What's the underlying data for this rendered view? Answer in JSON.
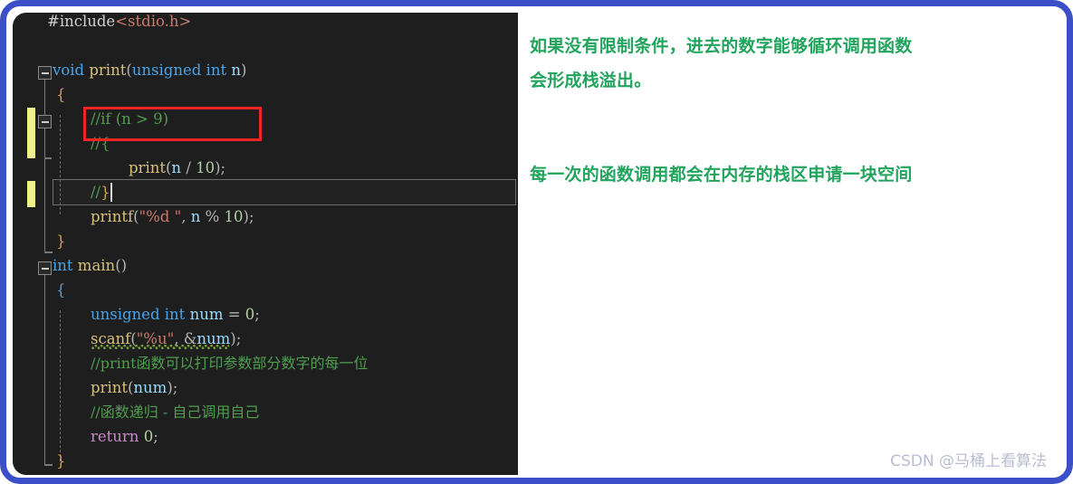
{
  "frame": {
    "border_color": "#3b50c8"
  },
  "editor": {
    "background": "#1e1e1e",
    "lines": [
      {
        "indent": 2,
        "text": "#include<stdio.h>"
      },
      {
        "indent": 0,
        "text": ""
      },
      {
        "indent": 1,
        "text": "void print(unsigned int n)"
      },
      {
        "indent": 2,
        "text": "{"
      },
      {
        "indent": 3,
        "text": "//if (n > 9)"
      },
      {
        "indent": 3,
        "text": "//{"
      },
      {
        "indent": 4,
        "text": "print(n / 10);"
      },
      {
        "indent": 3,
        "text": "//}"
      },
      {
        "indent": 3,
        "text": "printf(\"%d \", n % 10);"
      },
      {
        "indent": 2,
        "text": "}"
      },
      {
        "indent": 1,
        "text": "int main()"
      },
      {
        "indent": 2,
        "text": "{"
      },
      {
        "indent": 3,
        "text": "unsigned int num = 0;"
      },
      {
        "indent": 3,
        "text": "scanf(\"%u\", &num);"
      },
      {
        "indent": 3,
        "text": "//print函数可以打印参数部分数字的每一位"
      },
      {
        "indent": 3,
        "text": "print(num);"
      },
      {
        "indent": 3,
        "text": "//函数递归 - 自己调用自己"
      },
      {
        "indent": 3,
        "text": "return 0;"
      },
      {
        "indent": 2,
        "text": "}"
      }
    ],
    "tokens": {
      "include_directive": "#include",
      "include_header": "<stdio.h>",
      "kw_void": "void",
      "kw_unsigned": "unsigned",
      "kw_int": "int",
      "kw_return": "return",
      "fn_print": "print",
      "fn_printf": "printf",
      "fn_scanf": "scanf",
      "fn_main": "main",
      "var_n": "n",
      "var_num": "num",
      "num_0": "0",
      "num_9": "9",
      "num_10": "10",
      "str_d": "\"%d \"",
      "str_u": "\"%u\"",
      "comment_if": "//if (n > 9)",
      "comment_open": "//{",
      "comment_close": "//}",
      "comment_print_cn": "//print函数可以打印参数部分数字的每一位",
      "comment_recursion_cn": "//函数递归 - 自己调用自己"
    },
    "highlight": {
      "red_box_target": "//if (n > 9)",
      "red_box_color": "#ef2424",
      "current_line_target": "//}",
      "change_bar_color": "#f1f08a",
      "squiggle_target": "scanf(\"%u\", &num)"
    }
  },
  "notes": {
    "accent_color": "#22a45d",
    "items": [
      "如果没有限制条件，进去的数字能够循环调用函数\n会形成栈溢出。",
      "每一次的函数调用都会在内存的栈区申请一块空间"
    ]
  },
  "watermark": {
    "text": "CSDN @马桶上看算法"
  }
}
